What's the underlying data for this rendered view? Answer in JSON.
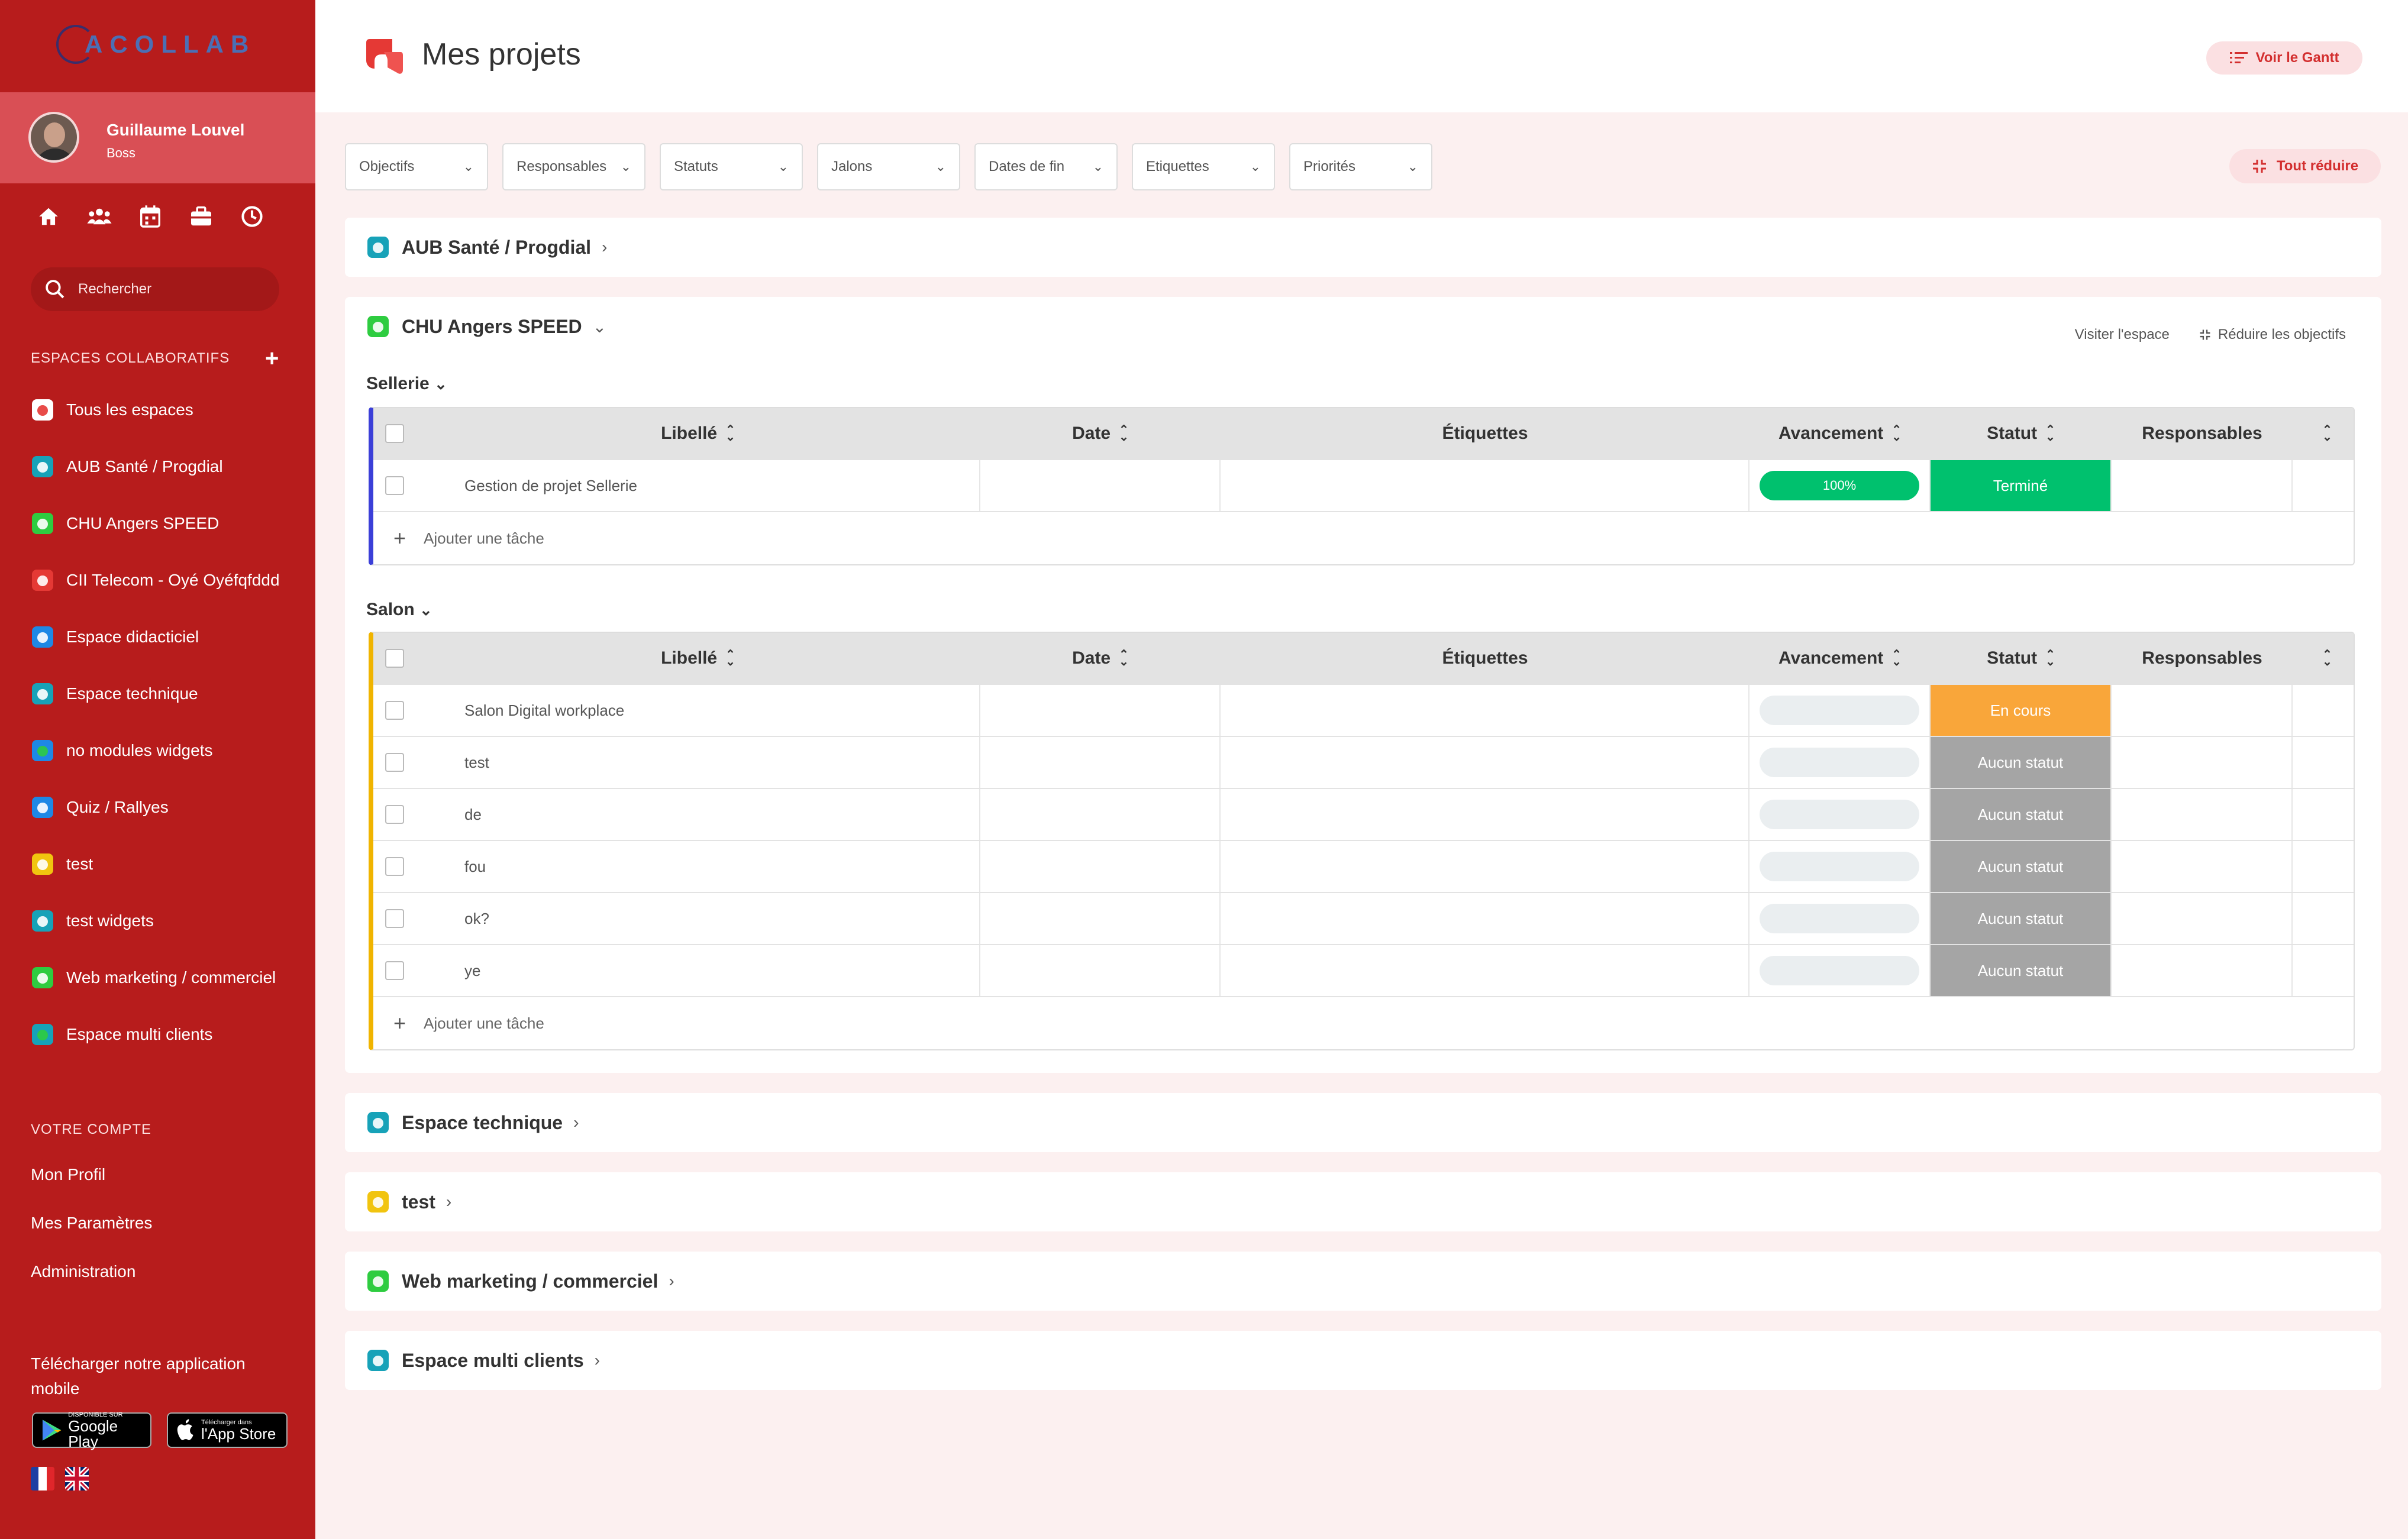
{
  "brand": {
    "logo_text": "ACOLLAB"
  },
  "user": {
    "name": "Guillaume Louvel",
    "role": "Boss"
  },
  "quick_nav": [
    "home-icon",
    "users-icon",
    "calendar-icon",
    "briefcase-icon",
    "clock-icon"
  ],
  "search": {
    "placeholder": "Rechercher"
  },
  "sidebar": {
    "spaces_heading": "ESPACES COLLABORATIFS",
    "spaces": [
      {
        "label": "Tous les espaces",
        "color": "#ffffff",
        "accent": "#e53935"
      },
      {
        "label": "AUB Santé / Progdial",
        "color": "#17a2b8",
        "accent": "#ffffff"
      },
      {
        "label": "CHU Angers SPEED",
        "color": "#2ecc40",
        "accent": "#ffffff"
      },
      {
        "label": "CII Telecom - Oyé Oyéfqfddd",
        "color": "#e53935",
        "accent": "#ffffff"
      },
      {
        "label": "Espace didacticiel",
        "color": "#1e88e5",
        "accent": "#ffffff"
      },
      {
        "label": "Espace technique",
        "color": "#17a2b8",
        "accent": "#ffffff"
      },
      {
        "label": "no modules widgets",
        "color": "#1e88e5",
        "accent": "#2ecc40"
      },
      {
        "label": "Quiz / Rallyes",
        "color": "#1e88e5",
        "accent": "#ffffff"
      },
      {
        "label": "test",
        "color": "#f1c40f",
        "accent": "#ffffff"
      },
      {
        "label": "test widgets",
        "color": "#17a2b8",
        "accent": "#ffffff"
      },
      {
        "label": "Web marketing / commerciel",
        "color": "#2ecc40",
        "accent": "#ffffff"
      },
      {
        "label": "Espace multi clients",
        "color": "#17a2b8",
        "accent": "#2ecc40"
      }
    ],
    "account_heading": "VOTRE COMPTE",
    "account": [
      "Mon Profil",
      "Mes Paramètres",
      "Administration"
    ],
    "download_text": "Télécharger notre application mobile",
    "google_small": "DISPONIBLE SUR",
    "google_big": "Google Play",
    "apple_small": "Télécharger dans",
    "apple_big": "l'App Store"
  },
  "header": {
    "title": "Mes projets",
    "gantt_label": "Voir le Gantt"
  },
  "filters": [
    "Objectifs",
    "Responsables",
    "Statuts",
    "Jalons",
    "Dates de fin",
    "Etiquettes",
    "Priorités"
  ],
  "reduce_all": "Tout réduire",
  "projects": [
    {
      "name": "AUB Santé / Progdial",
      "color": "#17a2b8"
    },
    {
      "name": "CHU Angers SPEED",
      "color": "#2ecc40",
      "visit": "Visiter l'espace",
      "reduce": "Réduire les objectifs",
      "columns": {
        "libelle": "Libellé",
        "date": "Date",
        "etiquettes": "Étiquettes",
        "avancement": "Avancement",
        "statut": "Statut",
        "responsables": "Responsables"
      },
      "add_task": "Ajouter une tâche",
      "groups": [
        {
          "name": "Sellerie",
          "color": "#3b3fd8",
          "tasks": [
            {
              "label": "Gestion de projet Sellerie",
              "progress": "100%",
              "progress_color": "#00c16e",
              "status": "Terminé",
              "status_color": "#00c16e"
            }
          ]
        },
        {
          "name": "Salon",
          "color": "#f0b400",
          "tasks": [
            {
              "label": "Salon Digital workplace",
              "progress": "",
              "progress_color": "#eaeef0",
              "status": "En cours",
              "status_color": "#f9a63a"
            },
            {
              "label": "test",
              "progress": "",
              "progress_color": "#eaeef0",
              "status": "Aucun statut",
              "status_color": "#a5a5a5"
            },
            {
              "label": "de",
              "progress": "",
              "progress_color": "#eaeef0",
              "status": "Aucun statut",
              "status_color": "#a5a5a5"
            },
            {
              "label": "fou",
              "progress": "",
              "progress_color": "#eaeef0",
              "status": "Aucun statut",
              "status_color": "#a5a5a5"
            },
            {
              "label": "ok?",
              "progress": "",
              "progress_color": "#eaeef0",
              "status": "Aucun statut",
              "status_color": "#a5a5a5"
            },
            {
              "label": "ye",
              "progress": "",
              "progress_color": "#eaeef0",
              "status": "Aucun statut",
              "status_color": "#a5a5a5"
            }
          ]
        }
      ]
    },
    {
      "name": "Espace technique",
      "color": "#17a2b8"
    },
    {
      "name": "test",
      "color": "#f1c40f"
    },
    {
      "name": "Web marketing / commerciel",
      "color": "#2ecc40"
    },
    {
      "name": "Espace multi clients",
      "color": "#17a2b8"
    }
  ],
  "colors": {
    "sidebar": "#b71c1c",
    "accent": "#d32f2f",
    "page_bg": "#fcf0f0"
  }
}
